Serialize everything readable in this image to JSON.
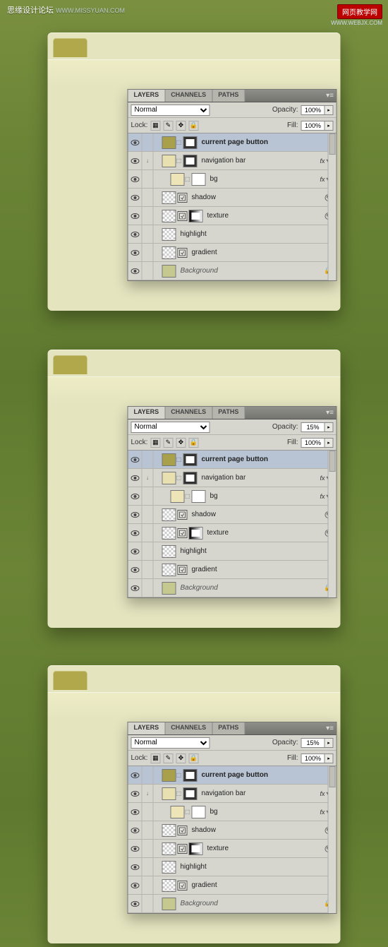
{
  "watermark_left": {
    "title": "思缘设计论坛",
    "sub": "WWW.MISSYUAN.COM"
  },
  "watermark_right": {
    "title": "网页教学网",
    "sub": "WWW.WEBJX.COM"
  },
  "panel": {
    "tabs": [
      "LAYERS",
      "CHANNELS",
      "PATHS"
    ],
    "blend_mode": "Normal",
    "opacity_label": "Opacity:",
    "fill_label": "Fill:",
    "lock_label": "Lock:",
    "fill_value": "100%"
  },
  "variants": [
    {
      "opacity": "100%",
      "sel_layer": 0
    },
    {
      "opacity": "15%",
      "sel_layer": 0
    },
    {
      "opacity": "15%",
      "sel_layer": 0
    }
  ],
  "layers": [
    {
      "name": "current page button",
      "bold": true,
      "thumb": "olive",
      "link": true,
      "mask": "dark",
      "indent": 10
    },
    {
      "name": "navigation bar",
      "thumb": "cream",
      "link": true,
      "mask": "dark",
      "fx": true,
      "indent": 10,
      "link_icon": "↓"
    },
    {
      "name": "bg",
      "thumb": "cream2",
      "link": true,
      "mask": "white",
      "fx": true,
      "indent": 22
    },
    {
      "name": "shadow",
      "thumb": "trans",
      "smart": true,
      "web": true,
      "indent": 10
    },
    {
      "name": "texture",
      "thumb": "trans",
      "smart": true,
      "mask": "grad",
      "web": true,
      "indent": 10
    },
    {
      "name": "highlight",
      "thumb": "trans",
      "indent": 10
    },
    {
      "name": "gradient",
      "thumb": "trans",
      "smart": true,
      "indent": 10
    },
    {
      "name": "Background",
      "thumb": "olive2",
      "lock": true,
      "ital": true,
      "indent": 10
    }
  ]
}
